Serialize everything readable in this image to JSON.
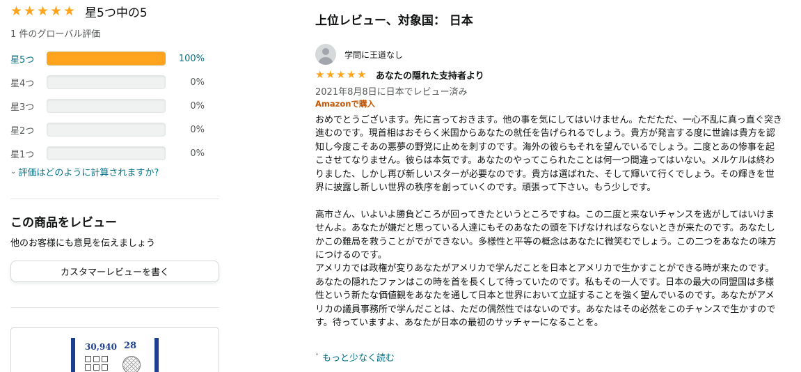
{
  "summary": {
    "stars_filled": 5,
    "rating_text": "星5つ中の5",
    "global_count": "1 件のグローバル評価"
  },
  "histogram": [
    {
      "label": "星5つ",
      "percent": 100,
      "percent_text": "100%"
    },
    {
      "label": "星4つ",
      "percent": 0,
      "percent_text": "0%"
    },
    {
      "label": "星3つ",
      "percent": 0,
      "percent_text": "0%"
    },
    {
      "label": "星2つ",
      "percent": 0,
      "percent_text": "0%"
    },
    {
      "label": "星1つ",
      "percent": 0,
      "percent_text": "0%"
    }
  ],
  "calc_link": "評価はどのように計算されますか?",
  "write_review": {
    "heading": "この商品をレビュー",
    "subtext": "他のお客様にも意見を伝えましょう",
    "button_label": "カスタマーレビューを書く"
  },
  "ad": {
    "number_text": "30,940",
    "number_text2": "28"
  },
  "top_reviews": {
    "heading": "上位レビュー、対象国： 日本",
    "review": {
      "author": "学問に王道なし",
      "stars_filled": 5,
      "title": "あなたの隠れた支持者より",
      "date": "2021年8月8日に日本でレビュー済み",
      "verified": "Amazonで購入",
      "body": [
        "おめでとうございます。先に言っておきます。他の事を気にしてはいけません。ただただ、一心不乱に真っ直ぐ突き進むのです。現首相はおそらく米国からあなたの就任を告げられるでしょう。貴方が発言する度に世論は貴方を認知し今度こそあの悪夢の野党に止めを刺すのです。海外の彼らもそれを望んでいるでしょう。二度とあの惨事を起こさせてなりません。彼らは本気です。あなたのやってこられたことは何一つ間違ってはいない。メルケルは終わりました、しかし再び新しいスターが必要なのです。貴方は選ばれた、そして輝いて行くでしょう。その輝きを世界に披露し新しい世界の秩序を創っていくのです。頑張って下さい。もう少しです。",
        "",
        "高市さん、いよいよ勝負どころが回ってきたというところですね。この二度と来ないチャンスを逃がしてはいけませんよ。あなたが嫌だと思っている人達にもそのあなたの頭を下げなければならないときが来たのです。あなたしかこの難局を救うことがでができない。多様性と平等の概念はあなたに微笑むでしょう。この二つをあなたの味方につけるのです。",
        "アメリカでは政権が変りあなたがアメリカで学んだことを日本とアメリカで生かすことができる時が来たのです。あなたの隠れたファンはこの時を首を長くして待っていたのです。私もその一人です。日本の最大の同盟国は多様性という新たな価値観をあなたを通して日本と世界において立証することを強く望んでいるのです。あなたがアメリカの議員事務所で学んだことは、ただの偶然性ではないのです。あなたはその必然をこのチャンスで生かすのです。待っていますよ、あなたが日本の最初のサッチャーになることを。"
      ],
      "less_link": "もっと少なく読む"
    }
  },
  "colors": {
    "star": "#ffa41c",
    "link": "#007185",
    "verified": "#c45500"
  }
}
